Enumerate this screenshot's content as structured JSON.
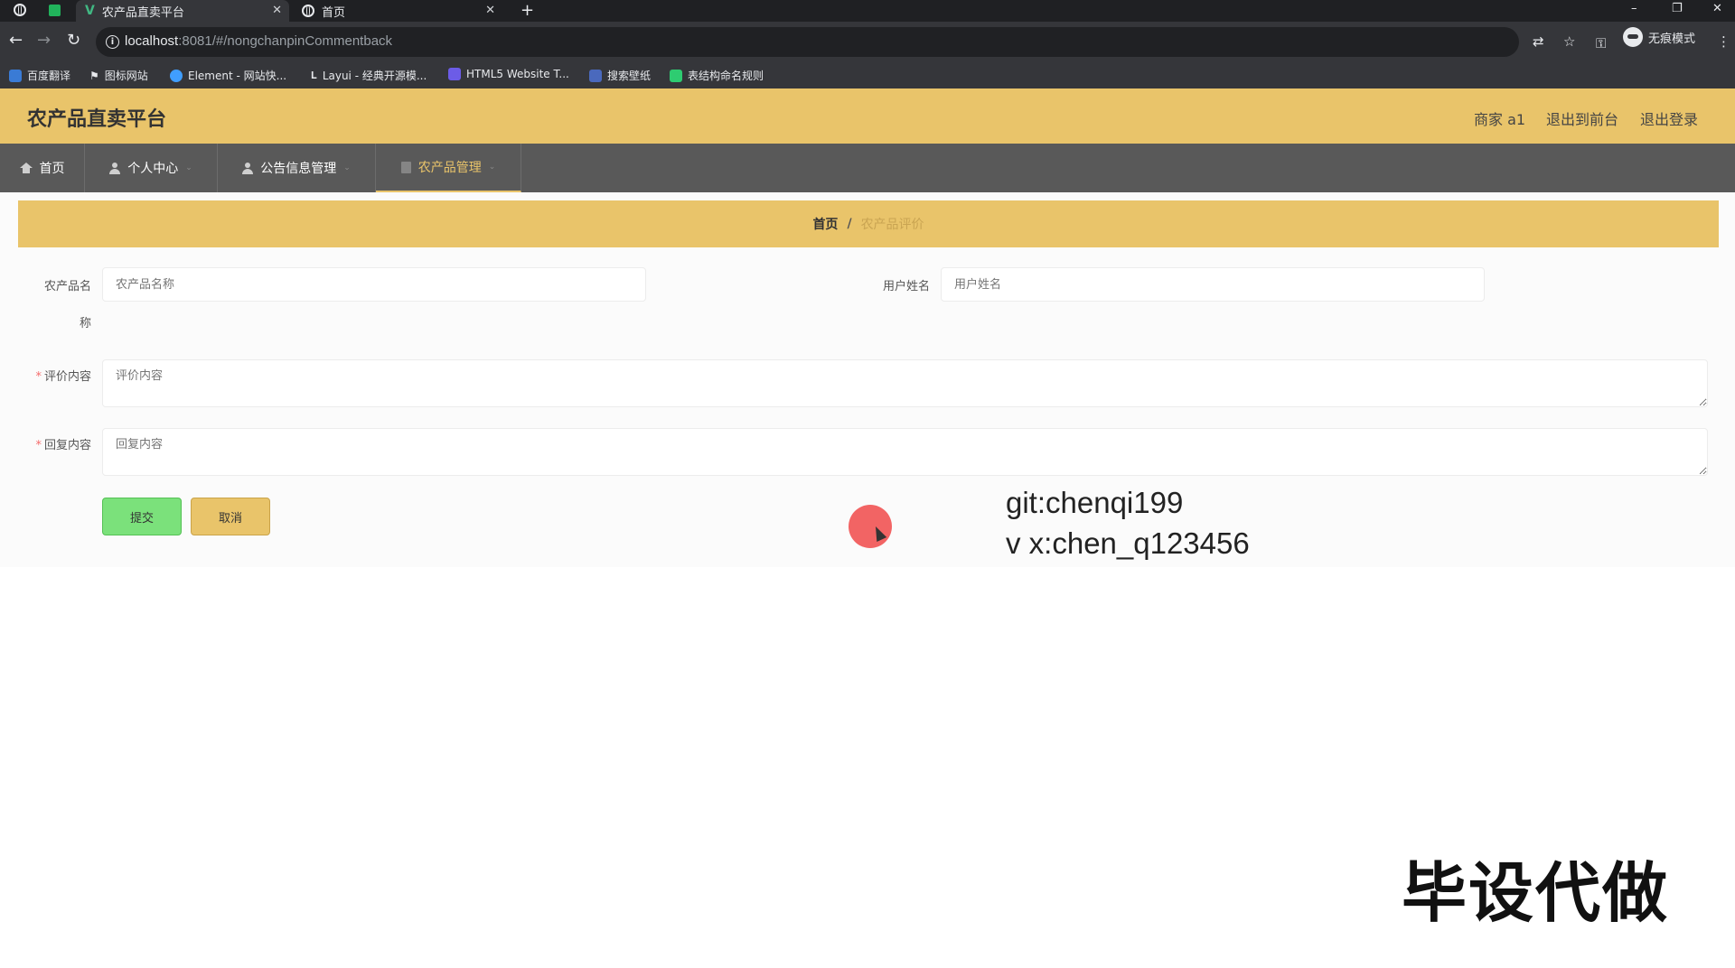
{
  "browser": {
    "tabs": [
      {
        "label": "农产品直卖平台",
        "close": "✕"
      },
      {
        "label": "首页",
        "close": "✕"
      }
    ],
    "new_tab": "+",
    "window_controls": {
      "minimize": "–",
      "restore": "❐",
      "close": "✕"
    },
    "url_host": "localhost",
    "url_path": ":8081/#/nongchanpinCommentback",
    "incognito_label": "无痕模式",
    "bookmarks": [
      {
        "label": "百度翻译",
        "color": "#3a7bd5"
      },
      {
        "label": "图标网站",
        "color": "#e8eaed"
      },
      {
        "label": "Element - 网站快...",
        "color": "#409eff"
      },
      {
        "label": "Layui - 经典开源模...",
        "color": "#e8eaed"
      },
      {
        "label": "HTML5 Website T...",
        "color": "#6c5ce7"
      },
      {
        "label": "搜索壁纸",
        "color": "#4a69bd"
      },
      {
        "label": "表结构命名规则",
        "color": "#2ecc71"
      }
    ]
  },
  "header": {
    "title": "农产品直卖平台",
    "links": [
      "商家 a1",
      "退出到前台",
      "退出登录"
    ]
  },
  "menu": {
    "items": [
      {
        "label": "首页",
        "icon": "home-icon",
        "has_caret": false,
        "active": false
      },
      {
        "label": "个人中心",
        "icon": "user-icon",
        "has_caret": true,
        "active": false
      },
      {
        "label": "公告信息管理",
        "icon": "user-icon",
        "has_caret": true,
        "active": false
      },
      {
        "label": "农产品管理",
        "icon": "document-icon",
        "has_caret": true,
        "active": true
      }
    ],
    "caret": "⌄"
  },
  "breadcrumb": {
    "home": "首页",
    "separator": "/",
    "current": "农产品评价"
  },
  "form": {
    "product_name_label_line1": "农产品名",
    "product_name_label_line2": "称",
    "product_name_placeholder": "农产品名称",
    "user_name_label": "用户姓名",
    "user_name_placeholder": "用户姓名",
    "required_mark": "*",
    "comment_label": "评价内容",
    "comment_placeholder": "评价内容",
    "reply_label": "回复内容",
    "reply_placeholder": "回复内容",
    "submit_label": "提交",
    "cancel_label": "取消"
  },
  "overlay": {
    "git": "git:chenqi199",
    "vx": "v x:chen_q123456",
    "watermark": "毕设代做"
  },
  "colors": {
    "accent": "#e9c46a",
    "menu_bg": "#595959",
    "submit": "#7be17b",
    "required": "#f56c6c"
  }
}
